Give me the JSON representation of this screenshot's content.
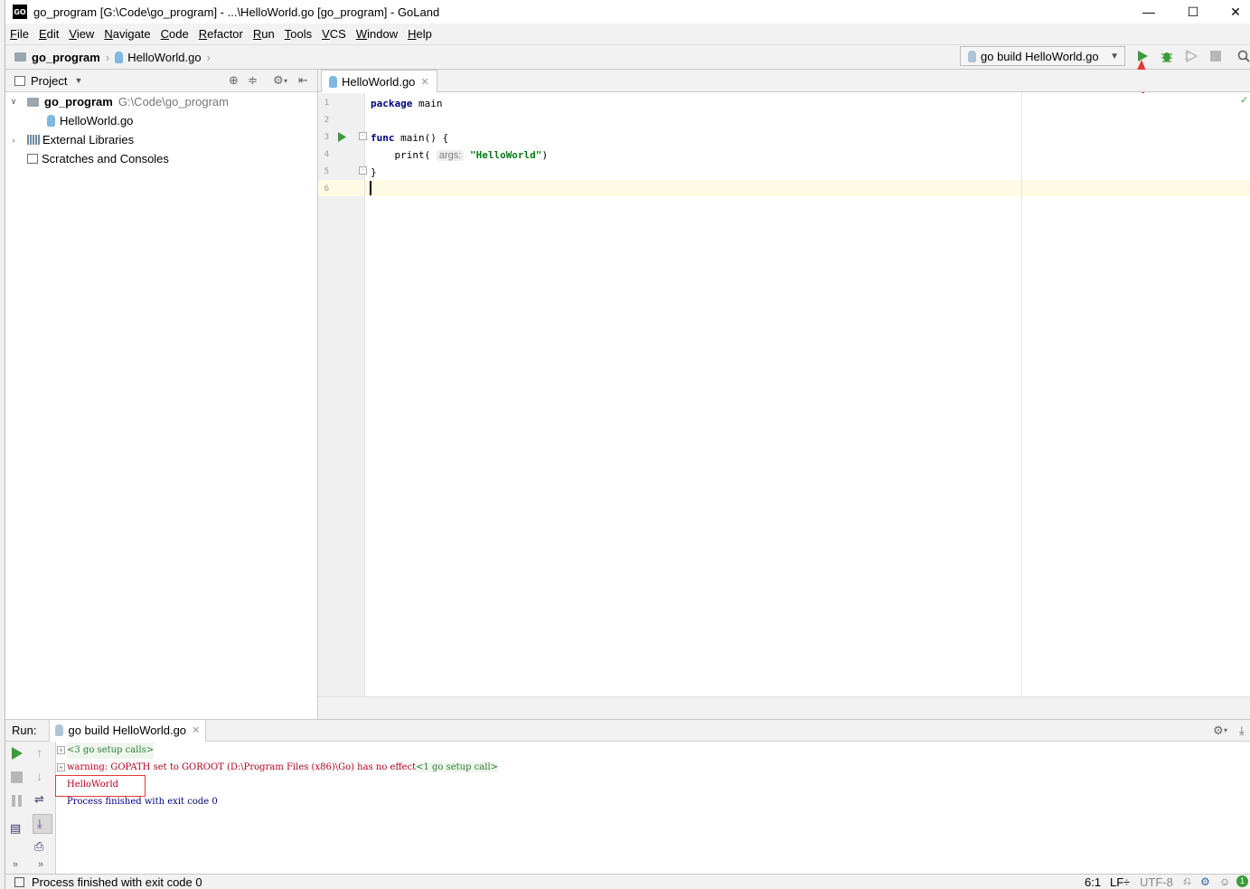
{
  "window": {
    "title": "go_program [G:\\Code\\go_program] - ...\\HelloWorld.go [go_program] - GoLand",
    "app_icon_text": "GO",
    "minimize": "—",
    "maximize": "☐",
    "close": "✕"
  },
  "menu": [
    {
      "mnemonic": "F",
      "rest": "ile"
    },
    {
      "mnemonic": "E",
      "rest": "dit"
    },
    {
      "mnemonic": "V",
      "rest": "iew"
    },
    {
      "mnemonic": "N",
      "rest": "avigate"
    },
    {
      "mnemonic": "C",
      "rest": "ode"
    },
    {
      "mnemonic": "R",
      "rest": "efactor"
    },
    {
      "mnemonic": "R",
      "rest": "un"
    },
    {
      "mnemonic": "T",
      "rest": "ools"
    },
    {
      "mnemonic": "V",
      "rest": "CS"
    },
    {
      "mnemonic": "W",
      "rest": "indow"
    },
    {
      "mnemonic": "H",
      "rest": "elp"
    }
  ],
  "breadcrumb": {
    "project": "go_program",
    "file": "HelloWorld.go"
  },
  "run_config": {
    "label": "go build HelloWorld.go"
  },
  "project_panel": {
    "title": "Project",
    "tree": [
      {
        "name": "go_program",
        "path": "G:\\Code\\go_program"
      },
      {
        "name": "HelloWorld.go"
      },
      {
        "name": "External Libraries"
      },
      {
        "name": "Scratches and Consoles"
      }
    ]
  },
  "editor": {
    "tab": "HelloWorld.go",
    "line_numbers": [
      "1",
      "2",
      "3",
      "4",
      "5",
      "6"
    ],
    "code": {
      "l1_kw": "package",
      "l1_rest": " main",
      "l3_kw": "func",
      "l3_rest": " main() {",
      "l4_pre": "    print(",
      "l4_hint": "args:",
      "l4_str": "\"HelloWorld\"",
      "l4_post": ")",
      "l5": "}"
    }
  },
  "run_panel": {
    "label": "Run:",
    "tab": "go build HelloWorld.go",
    "console": {
      "setup_calls": "<3 go setup calls>",
      "warning": "warning: GOPATH set to GOROOT (D:\\Program Files (x86)\\Go) has no effect",
      "setup_call": "<1 go setup call>",
      "output": "HelloWorld",
      "process": "Process finished with exit code 0"
    }
  },
  "status": {
    "message": "Process finished with exit code 0",
    "position": "6:1",
    "line_sep": "LF÷",
    "encoding": "UTF-8",
    "badge": "1"
  },
  "colors": {
    "accent_run": "#3b9c3b",
    "annotation": "#e53935"
  }
}
